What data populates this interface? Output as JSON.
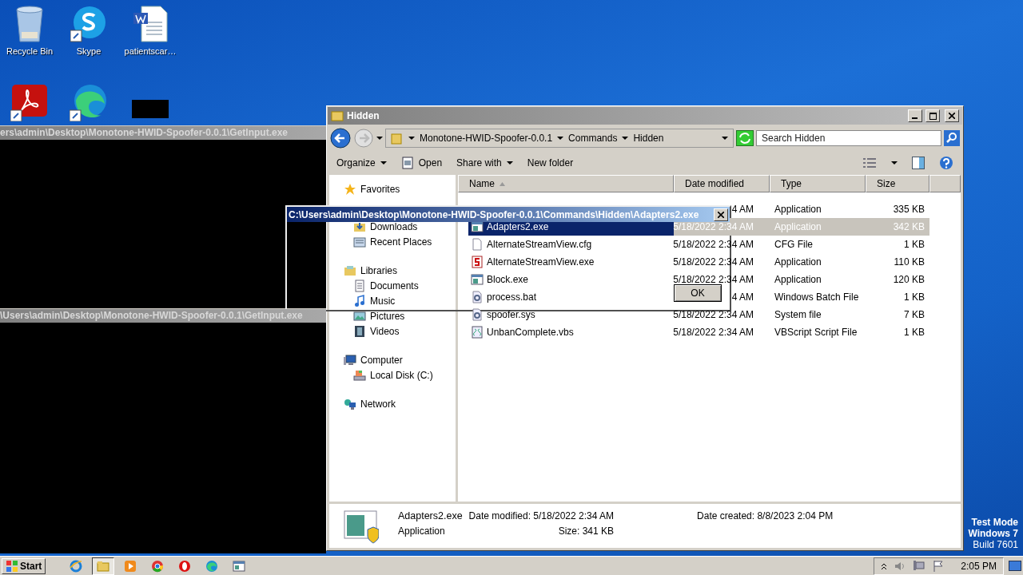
{
  "desktop_icons": [
    {
      "kind": "recycle",
      "label": "Recycle Bin"
    },
    {
      "kind": "skype",
      "label": "Skype"
    },
    {
      "kind": "word",
      "label": "patientscar…"
    },
    {
      "kind": "pdf"
    },
    {
      "kind": "edge"
    },
    {
      "kind": "blank"
    }
  ],
  "consoles": [
    {
      "title": "ers\\admin\\Desktop\\Monotone-HWID-Spoofer-0.0.1\\GetInput.exe"
    },
    {
      "title": "\\Users\\admin\\Desktop\\Monotone-HWID-Spoofer-0.0.1\\GetInput.exe"
    }
  ],
  "explorer": {
    "title": "Hidden",
    "breadcrumbs": [
      "Monotone-HWID-Spoofer-0.0.1",
      "Commands",
      "Hidden"
    ],
    "search": {
      "placeholder": "Search Hidden"
    },
    "toolbar": [
      {
        "label": "Organize",
        "kind": "menu"
      },
      {
        "label": "Open",
        "kind": "icon"
      },
      {
        "label": "Share with",
        "kind": "menu"
      },
      {
        "label": "New folder",
        "kind": "plain"
      }
    ],
    "sidebar": [
      {
        "label": "Favorites",
        "kind": "star",
        "children": [
          {
            "label": "Downloads",
            "kind": "downloads"
          },
          {
            "label": "Recent Places",
            "kind": "recent"
          }
        ]
      },
      {
        "label": "Libraries",
        "kind": "library",
        "children": [
          {
            "label": "Documents",
            "kind": "documents"
          },
          {
            "label": "Music",
            "kind": "music"
          },
          {
            "label": "Pictures",
            "kind": "pictures"
          },
          {
            "label": "Videos",
            "kind": "videos"
          }
        ]
      },
      {
        "label": "Computer",
        "kind": "computer",
        "children": [
          {
            "label": "Local Disk (C:)",
            "kind": "disk"
          }
        ]
      },
      {
        "label": "Network",
        "kind": "network"
      }
    ],
    "columns": [
      {
        "label": "Name",
        "sorted": true
      },
      {
        "label": "Date modified",
        "sorted": false
      },
      {
        "label": "Type",
        "sorted": false
      },
      {
        "label": "Size",
        "sorted": false
      }
    ],
    "files": [
      {
        "date": "4 AM",
        "type": "Application",
        "size": "335 KB",
        "selected": false
      },
      {
        "name": "Adapters2.exe",
        "kind": "app",
        "date": "5/18/2022 2:34 AM",
        "type": "Application",
        "size": "342 KB",
        "selected": true
      },
      {
        "name": "AlternateStreamView.cfg",
        "kind": "file",
        "date": "5/18/2022 2:34 AM",
        "type": "CFG File",
        "size": "1 KB",
        "selected": false
      },
      {
        "name": "AlternateStreamView.exe",
        "kind": "redapp",
        "date": "5/18/2022 2:34 AM",
        "type": "Application",
        "size": "110 KB",
        "selected": false
      },
      {
        "name": "Block.exe",
        "kind": "app",
        "date": "5/18/2022 2:34 AM",
        "type": "Application",
        "size": "120 KB",
        "selected": false
      },
      {
        "name": "process.bat",
        "kind": "gear",
        "date": "4 AM",
        "type": "Windows Batch File",
        "size": "1 KB",
        "selected": false
      },
      {
        "name": "spoofer.sys",
        "kind": "gear",
        "date": "5/18/2022 2:34 AM",
        "type": "System file",
        "size": "7 KB",
        "selected": false
      },
      {
        "name": "UnbanComplete.vbs",
        "kind": "script",
        "date": "5/18/2022 2:34 AM",
        "type": "VBScript Script File",
        "size": "1 KB",
        "selected": false
      }
    ],
    "details": {
      "name": "Adapters2.exe",
      "type": "Application",
      "modified": "Date modified: 5/18/2022 2:34 AM",
      "size": "Size: 341 KB",
      "created": "Date created: 8/8/2023 2:04 PM"
    }
  },
  "dialog": {
    "title": "C:\\Users\\admin\\Desktop\\Monotone-HWID-Spoofer-0.0.1\\Commands\\Hidden\\Adapters2.exe",
    "button": "OK"
  },
  "system_text": [
    "Test Mode",
    "Windows 7",
    "Build 7601"
  ],
  "taskbar": {
    "start": "Start",
    "apps": [
      {
        "kind": "ie",
        "active": false
      },
      {
        "kind": "explorer",
        "active": true
      },
      {
        "kind": "media",
        "active": false
      },
      {
        "kind": "chrome",
        "active": false
      },
      {
        "kind": "opera",
        "active": false
      },
      {
        "kind": "edge",
        "active": false
      },
      {
        "kind": "console",
        "active": false
      }
    ],
    "clock": "2:05 PM"
  }
}
